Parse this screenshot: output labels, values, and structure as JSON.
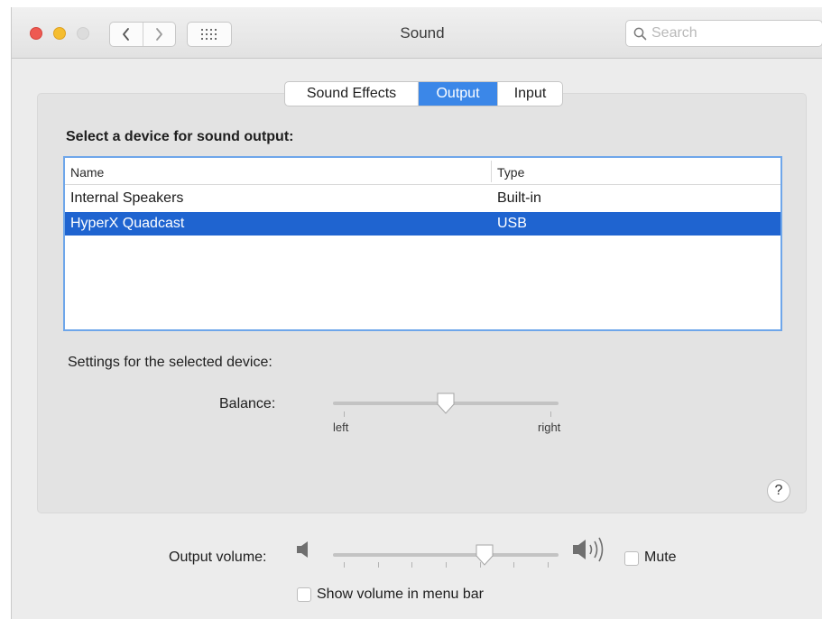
{
  "window": {
    "title": "Sound",
    "search_placeholder": "Search"
  },
  "tabs": [
    {
      "label": "Sound Effects",
      "active": false
    },
    {
      "label": "Output",
      "active": true
    },
    {
      "label": "Input",
      "active": false
    }
  ],
  "output": {
    "heading": "Select a device for sound output:",
    "columns": [
      "Name",
      "Type"
    ],
    "devices": [
      {
        "name": "Internal Speakers",
        "type": "Built-in",
        "selected": false
      },
      {
        "name": "HyperX Quadcast",
        "type": "USB",
        "selected": true
      }
    ],
    "settings_label": "Settings for the selected device:",
    "balance": {
      "label": "Balance:",
      "min_label": "left",
      "max_label": "right",
      "value": 0.5
    }
  },
  "footer": {
    "volume_label": "Output volume:",
    "volume_value": 0.67,
    "mute_label": "Mute",
    "mute_checked": false,
    "show_in_menubar_label": "Show volume in menu bar",
    "show_in_menubar_checked": false
  },
  "help_glyph": "?",
  "icons": [
    "chevron-left-icon",
    "chevron-right-icon",
    "grid-icon",
    "search-icon",
    "speaker-low-icon",
    "speaker-high-icon",
    "help-icon"
  ],
  "colors": {
    "accent": "#3b87e8",
    "selection": "#1f64d0",
    "close": "#ee5a52",
    "minimize": "#f5bd2f",
    "zoom": "#dcdcdc"
  }
}
